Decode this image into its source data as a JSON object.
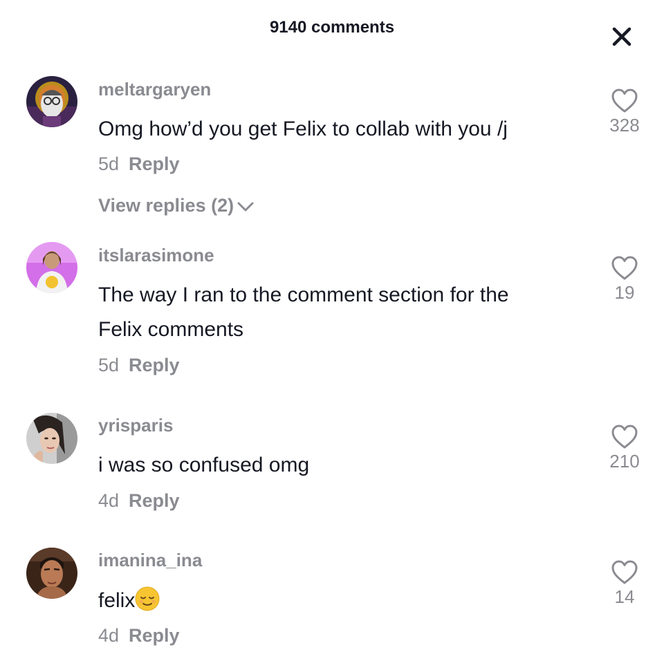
{
  "header": {
    "title": "9140 comments",
    "close_icon": "close-icon"
  },
  "comments": [
    {
      "username": "meltargaryen",
      "text": "Omg how’d you get Felix to collab with you /j",
      "age": "5d",
      "reply_label": "Reply",
      "likes": "328",
      "view_replies": "View replies (2)"
    },
    {
      "username": "itslarasimone",
      "text_line1": "The way I ran to the comment section for the",
      "text_line2": "Felix comments",
      "age": "5d",
      "reply_label": "Reply",
      "likes": "19"
    },
    {
      "username": "yrisparis",
      "text": "i was so confused omg",
      "age": "4d",
      "reply_label": "Reply",
      "likes": "210"
    },
    {
      "username": "imanina_ina",
      "text": "felix",
      "emoji": "relieved-face-emoji",
      "age": "4d",
      "reply_label": "Reply",
      "likes": "14"
    }
  ],
  "colors": {
    "primary_text": "#161823",
    "secondary_text": "#8a8b91"
  }
}
